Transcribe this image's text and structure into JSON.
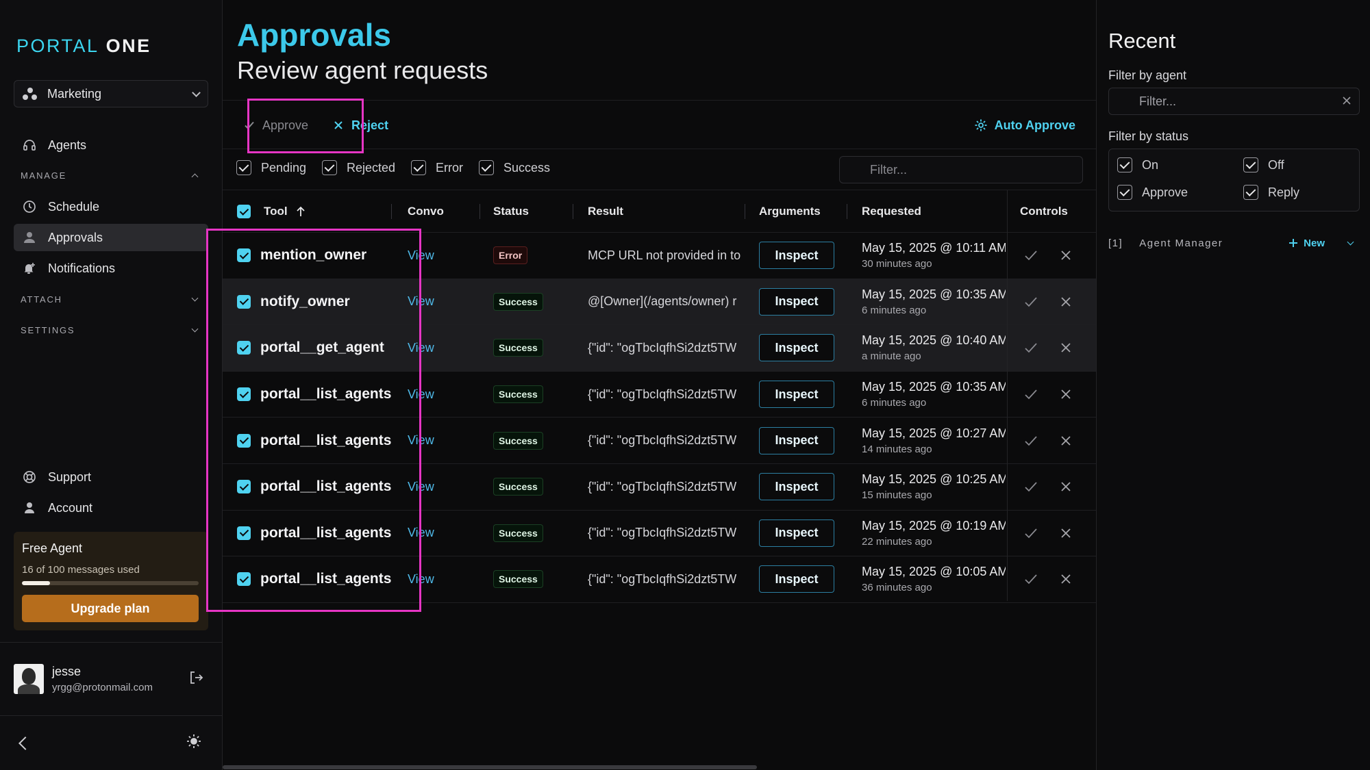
{
  "sidebar": {
    "logo_part1": "PORTAL",
    "logo_part2": "ONE",
    "workspace": "Marketing",
    "agents_label": "Agents",
    "manage_label": "MANAGE",
    "schedule_label": "Schedule",
    "approvals_label": "Approvals",
    "notifications_label": "Notifications",
    "attach_label": "ATTACH",
    "settings_label": "SETTINGS",
    "support_label": "Support",
    "account_label": "Account",
    "plan": {
      "title": "Free Agent",
      "usage": "16 of 100 messages used",
      "used_fraction": 0.16,
      "upgrade_label": "Upgrade plan"
    },
    "user": {
      "name": "jesse",
      "email": "yrgg@protonmail.com"
    }
  },
  "main": {
    "title": "Approvals",
    "subtitle": "Review agent requests",
    "toolbar": {
      "approve_label": "Approve",
      "reject_label": "Reject",
      "auto_approve_label": "Auto Approve"
    },
    "status_filters": [
      "Pending",
      "Rejected",
      "Error",
      "Success"
    ],
    "filter_placeholder": "Filter...",
    "columns": {
      "tool": "Tool",
      "convo": "Convo",
      "status": "Status",
      "result": "Result",
      "arguments": "Arguments",
      "requested": "Requested",
      "controls": "Controls"
    },
    "view_label": "View",
    "inspect_label": "Inspect",
    "rows": [
      {
        "tool": "mention_owner",
        "status": "Error",
        "result": "MCP URL not provided in to",
        "date": "May 15, 2025 @ 10:11 AM",
        "ago": "30 minutes ago"
      },
      {
        "tool": "notify_owner",
        "status": "Success",
        "result": "@[Owner](/agents/owner) r",
        "date": "May 15, 2025 @ 10:35 AM",
        "ago": "6 minutes ago"
      },
      {
        "tool": "portal__get_agent",
        "status": "Success",
        "result": "{\"id\": \"ogTbcIqfhSi2dzt5TW",
        "date": "May 15, 2025 @ 10:40 AM",
        "ago": "a minute ago"
      },
      {
        "tool": "portal__list_agents",
        "status": "Success",
        "result": "{\"id\": \"ogTbcIqfhSi2dzt5TW",
        "date": "May 15, 2025 @ 10:35 AM",
        "ago": "6 minutes ago"
      },
      {
        "tool": "portal__list_agents",
        "status": "Success",
        "result": "{\"id\": \"ogTbcIqfhSi2dzt5TW",
        "date": "May 15, 2025 @ 10:27 AM",
        "ago": "14 minutes ago"
      },
      {
        "tool": "portal__list_agents",
        "status": "Success",
        "result": "{\"id\": \"ogTbcIqfhSi2dzt5TW",
        "date": "May 15, 2025 @ 10:25 AM",
        "ago": "15 minutes ago"
      },
      {
        "tool": "portal__list_agents",
        "status": "Success",
        "result": "{\"id\": \"ogTbcIqfhSi2dzt5TW",
        "date": "May 15, 2025 @ 10:19 AM",
        "ago": "22 minutes ago"
      },
      {
        "tool": "portal__list_agents",
        "status": "Success",
        "result": "{\"id\": \"ogTbcIqfhSi2dzt5TW",
        "date": "May 15, 2025 @ 10:05 AM",
        "ago": "36 minutes ago"
      }
    ]
  },
  "recent": {
    "title": "Recent",
    "filter_agent_label": "Filter by agent",
    "filter_placeholder": "Filter...",
    "filter_status_label": "Filter by status",
    "statuses": [
      "On",
      "Off",
      "Approve",
      "Reply"
    ],
    "agent_index": "[1]",
    "agent_name": "Agent Manager",
    "new_label": "New"
  },
  "colors": {
    "accent": "#4fd2f0",
    "annotation": "#e635c4",
    "upgrade": "#b66d1c"
  }
}
